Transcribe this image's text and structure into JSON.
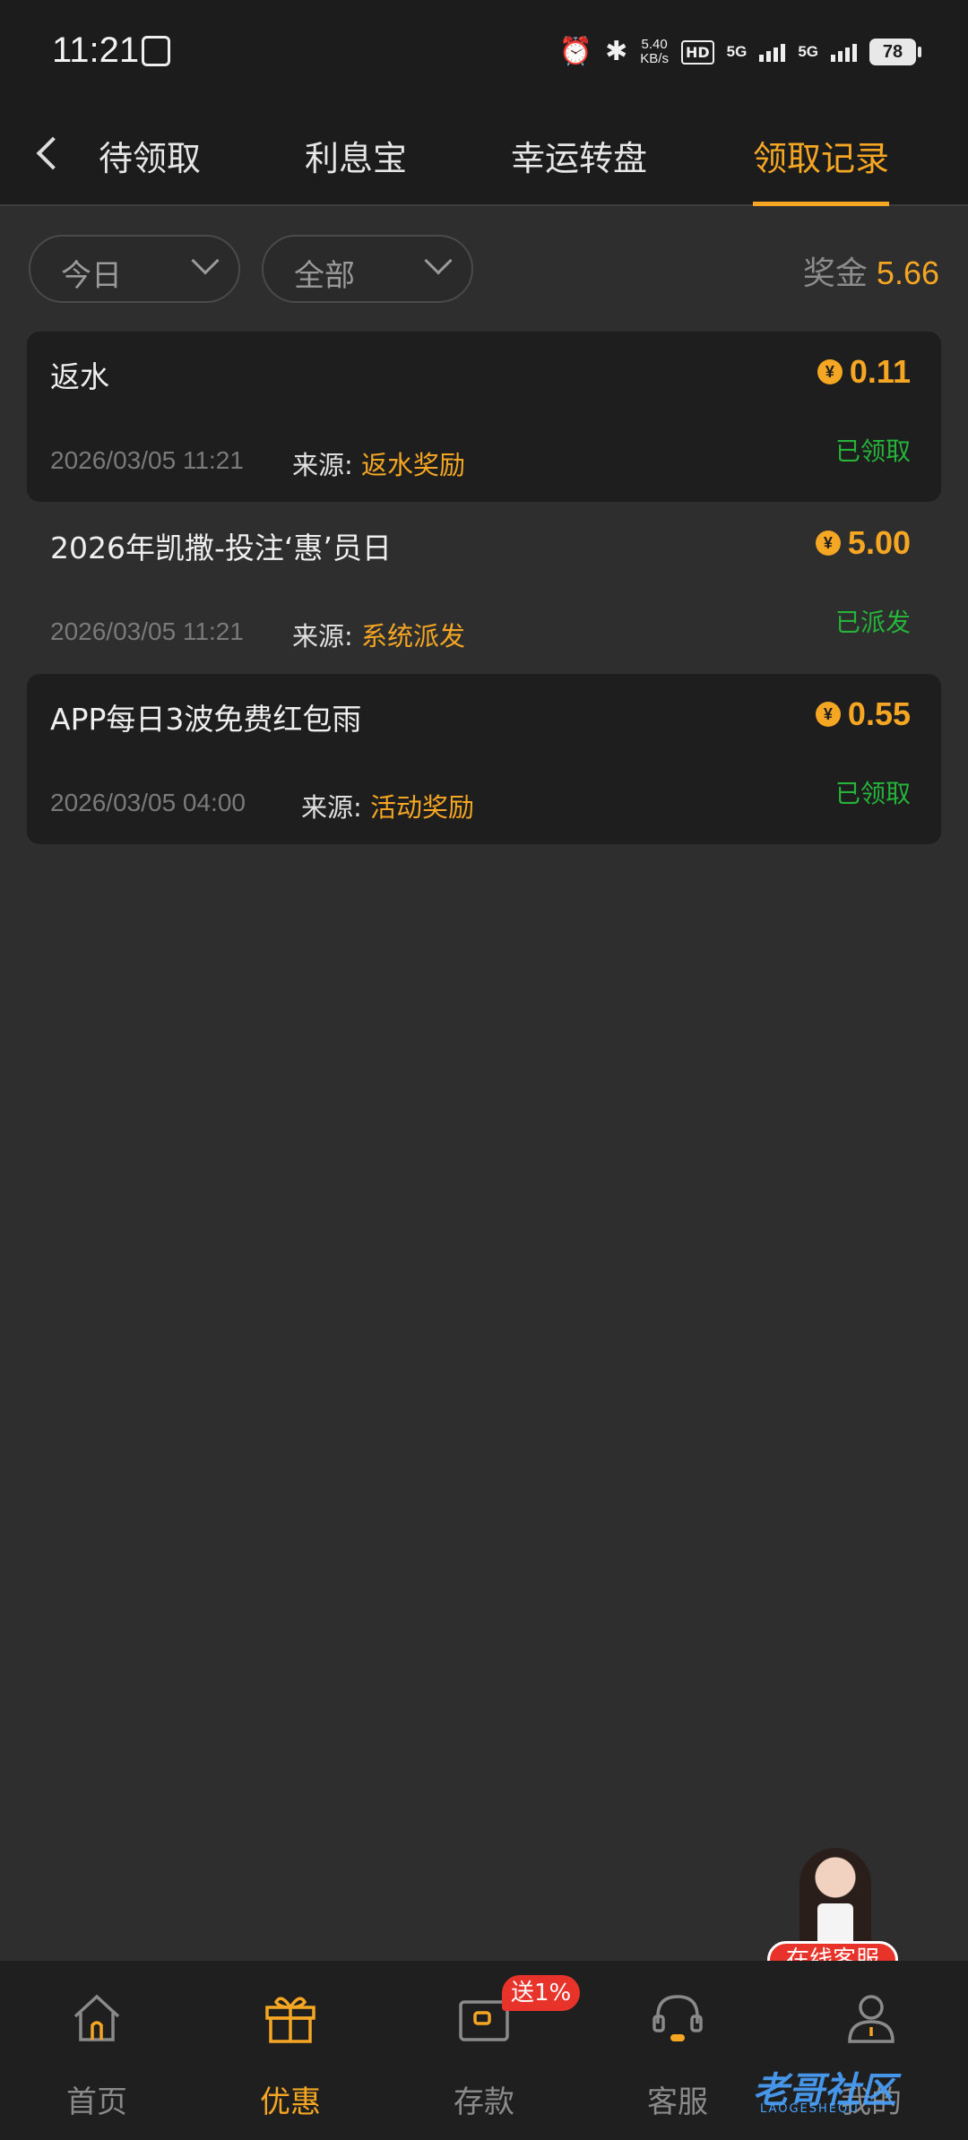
{
  "status_bar": {
    "time": "11:21",
    "speed": "5.40",
    "speed_unit": "KB/s",
    "network1": "5G",
    "network2": "5G",
    "battery": "78"
  },
  "nav": {
    "tabs": [
      {
        "label": "待领取",
        "active": false
      },
      {
        "label": "利息宝",
        "active": false
      },
      {
        "label": "幸运转盘",
        "active": false
      },
      {
        "label": "领取记录",
        "active": true
      }
    ]
  },
  "filters": {
    "date": "今日",
    "type": "全部",
    "bonus_label": "奖金",
    "bonus_value": "5.66"
  },
  "records": [
    {
      "title": "返水",
      "amount": "0.11",
      "status": "已领取",
      "time": "2026/03/05 11:21",
      "source_label": "来源:",
      "source": "返水奖励"
    },
    {
      "title": "2026年凯撒-投注‘惠’员日",
      "amount": "5.00",
      "status": "已派发",
      "time": "2026/03/05 11:21",
      "source_label": "来源:",
      "source": "系统派发"
    },
    {
      "title": "APP每日3波免费红包雨",
      "amount": "0.55",
      "status": "已领取",
      "time": "2026/03/05 04:00",
      "source_label": "来源:",
      "source": "活动奖励"
    }
  ],
  "coin_symbol": "¥",
  "customer_service": {
    "label": "在线客服"
  },
  "bottom_nav": {
    "items": [
      {
        "label": "首页",
        "icon": "home-icon",
        "active": false
      },
      {
        "label": "优惠",
        "icon": "gift-icon",
        "active": true
      },
      {
        "label": "存款",
        "icon": "wallet-icon",
        "active": false
      },
      {
        "label": "客服",
        "icon": "headset-icon",
        "active": false
      },
      {
        "label": "我的",
        "icon": "user-icon",
        "active": false
      }
    ],
    "deposit_badge": "送1%"
  },
  "watermark": {
    "text": "老哥社区",
    "sub": "LAOGESHEQU"
  },
  "colors": {
    "accent": "#f5a623",
    "success": "#26b33a",
    "badge": "#e8332a"
  }
}
